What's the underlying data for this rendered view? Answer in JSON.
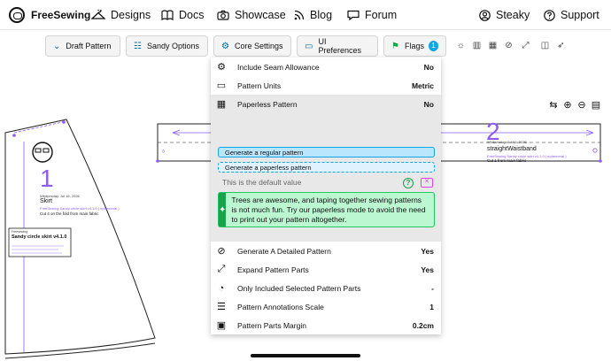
{
  "nav": {
    "brand": "FreeSewing",
    "designs": "Designs",
    "docs": "Docs",
    "showcase": "Showcase",
    "blog": "Blog",
    "forum": "Forum",
    "user": "Steaky",
    "support": "Support"
  },
  "toolbar": {
    "draft": "Draft Pattern",
    "design_options": "Sandy Options",
    "core": "Core Settings",
    "ui": "UI Preferences",
    "flags": "Flags",
    "flags_count": "1"
  },
  "menu": {
    "rows_top": [
      {
        "label": "Include Seam Allowance",
        "value": "No"
      },
      {
        "label": "Pattern Units",
        "value": "Metric"
      },
      {
        "label": "Paperless Pattern",
        "value": "No"
      }
    ],
    "options": [
      "Generate a regular pattern",
      "Generate a paperless pattern"
    ],
    "default_note": "This is the default value",
    "tip": "Trees are awesome, and taping together sewing patterns is not much fun. Try our paperless mode to avoid the need to print out your pattern altogether.",
    "rows_bottom": [
      {
        "label": "Generate A Detailed Pattern",
        "value": "Yes"
      },
      {
        "label": "Expand Pattern Parts",
        "value": "Yes"
      },
      {
        "label": "Only Included Selected Pattern Parts",
        "value": "-"
      },
      {
        "label": "Pattern Annotations Scale",
        "value": "1"
      },
      {
        "label": "Pattern Parts Margin",
        "value": "0.2cm"
      }
    ]
  },
  "pattern": {
    "part1": {
      "number": "1",
      "date": "Wednesday, Jul 16, 2026",
      "name": "Skirt",
      "version": "FreeSewing Sandy circle skirt v4.1.0 ( ephemeral )",
      "cut": "Cut 4 on the fold from main fabric"
    },
    "part2": {
      "number": "2",
      "date": "Wednesday, Jul 16, 2026",
      "name": "straightWaistband",
      "version": "FreeSewing Sandy circle skirt v4.1.0 ( ephemeral )",
      "cut": "Cut 1 from main fabric"
    },
    "title_box": {
      "small": "Freesewing",
      "title": "Sandy circle skirt v4.1.0"
    }
  },
  "colors": {
    "accent": "#0ea5e9",
    "pattern_number": "#8b5cf6",
    "tip_bg": "#bbf7d0",
    "tip_border": "#22c55e"
  }
}
